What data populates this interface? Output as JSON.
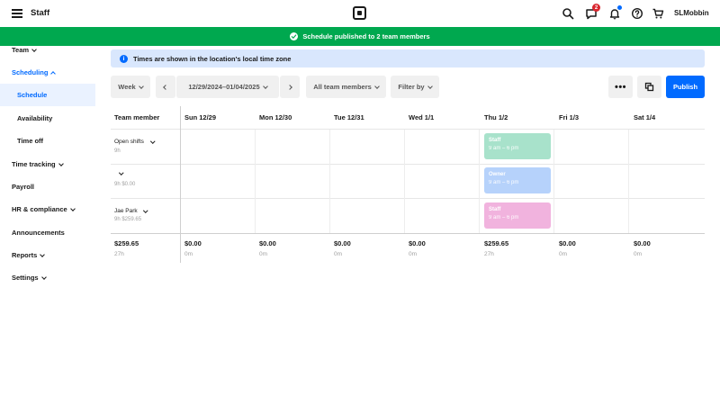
{
  "header": {
    "title": "Staff",
    "user_name": "SLMobbin",
    "notifications_badge": "2"
  },
  "banner": {
    "success": "Schedule published to 2 team members",
    "info": "Times are shown in the location's local time zone"
  },
  "sidebar": {
    "items": [
      {
        "label": "Team"
      },
      {
        "label": "Scheduling"
      },
      {
        "label": "Schedule"
      },
      {
        "label": "Availability"
      },
      {
        "label": "Time off"
      },
      {
        "label": "Time tracking"
      },
      {
        "label": "Payroll"
      },
      {
        "label": "HR & compliance"
      },
      {
        "label": "Announcements"
      },
      {
        "label": "Reports"
      },
      {
        "label": "Settings"
      }
    ]
  },
  "toolbar": {
    "view": "Week",
    "date_range": "12/29/2024–01/04/2025",
    "members": "All team members",
    "filter": "Filter by",
    "publish": "Publish"
  },
  "grid": {
    "team_member_header": "Team member",
    "days": [
      "Sun 12/29",
      "Mon 12/30",
      "Tue 12/31",
      "Wed 1/1",
      "Thu 1/2",
      "Fri 1/3",
      "Sat 1/4"
    ],
    "rows": [
      {
        "name": "Open shifts",
        "meta": "9h"
      },
      {
        "name": "",
        "meta": "9h  $0.00"
      },
      {
        "name": "Jae Park",
        "meta": "9h  $259.65"
      }
    ],
    "shifts": [
      {
        "role": "Staff",
        "time": "9 am – 6 pm",
        "color": "#a8e2cb"
      },
      {
        "role": "Owner",
        "time": "9 am – 6 pm",
        "color": "#b6d2fb"
      },
      {
        "role": "Staff",
        "time": "9 am – 6 pm",
        "color": "#f1b3de"
      }
    ],
    "totals": {
      "overall_amount": "$259.65",
      "overall_hours": "27h",
      "days": [
        {
          "amount": "$0.00",
          "hours": "0m"
        },
        {
          "amount": "$0.00",
          "hours": "0m"
        },
        {
          "amount": "$0.00",
          "hours": "0m"
        },
        {
          "amount": "$0.00",
          "hours": "0m"
        },
        {
          "amount": "$259.65",
          "hours": "27h"
        },
        {
          "amount": "$0.00",
          "hours": "0m"
        },
        {
          "amount": "$0.00",
          "hours": "0m"
        }
      ]
    }
  },
  "colors": {
    "accent": "#006aff",
    "success": "#00a84f",
    "info_bg": "#d9e7fd",
    "selected_bg": "#eaf2ff"
  }
}
